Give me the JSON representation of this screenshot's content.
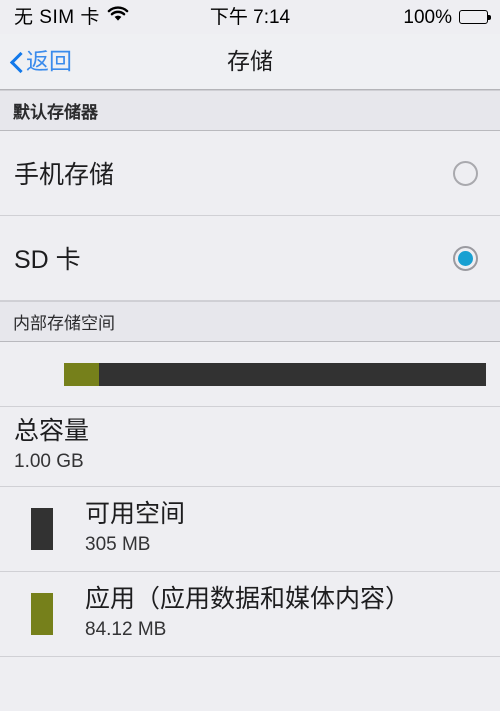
{
  "status_bar": {
    "carrier": "无 SIM 卡",
    "wifi_icon": "wifi-icon",
    "time": "下午 7:14",
    "battery_percent": "100%",
    "battery_icon": "battery-full-icon"
  },
  "nav": {
    "back_label": "返回",
    "back_icon": "chevron-left-icon",
    "title": "存储"
  },
  "sections": {
    "default_storage": {
      "header": "默认存储器",
      "options": [
        {
          "label": "手机存储",
          "selected": false
        },
        {
          "label": "SD 卡",
          "selected": true
        }
      ]
    },
    "internal_storage": {
      "header": "内部存储空间",
      "bar": {
        "segments": [
          {
            "name": "apps",
            "color": "#76801b",
            "percent": 8.2
          },
          {
            "name": "free",
            "color": "#323232",
            "percent": 91.8
          }
        ]
      },
      "total": {
        "title": "总容量",
        "value": "1.00 GB"
      },
      "legend": [
        {
          "color": "#323232",
          "title": "可用空间",
          "value": "305 MB"
        },
        {
          "color": "#76801b",
          "title": "应用（应用数据和媒体内容）",
          "value": "84.12 MB"
        }
      ]
    }
  },
  "colors": {
    "accent_blue": "#1279ea",
    "radio_blue": "#18a0d2",
    "olive": "#76801b",
    "dark_gray": "#323232",
    "background": "#eeeef2"
  },
  "chart_data": {
    "type": "bar",
    "title": "内部存储空间",
    "categories": [
      "应用（应用数据和媒体内容）",
      "可用空间"
    ],
    "values": [
      84.12,
      305
    ],
    "units": "MB",
    "total": 1024,
    "total_label": "1.00 GB",
    "colors": [
      "#76801b",
      "#323232"
    ],
    "orientation": "horizontal-stacked",
    "legend": "below"
  }
}
